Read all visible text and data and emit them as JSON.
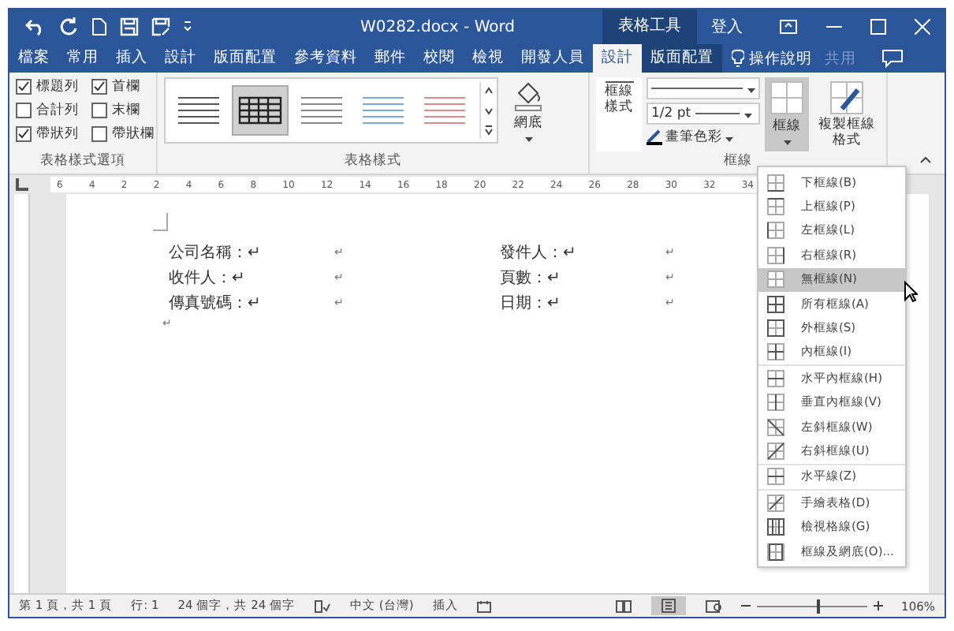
{
  "title_bar": {
    "document_title": "W0282.docx - Word",
    "context_label": "表格工具",
    "sign_in": "登入"
  },
  "tabs": [
    {
      "label": "檔案",
      "selected": false,
      "contextual": false
    },
    {
      "label": "常用",
      "selected": false,
      "contextual": false
    },
    {
      "label": "插入",
      "selected": false,
      "contextual": false
    },
    {
      "label": "設計",
      "selected": false,
      "contextual": false
    },
    {
      "label": "版面配置",
      "selected": false,
      "contextual": false
    },
    {
      "label": "參考資料",
      "selected": false,
      "contextual": false
    },
    {
      "label": "郵件",
      "selected": false,
      "contextual": false
    },
    {
      "label": "校閱",
      "selected": false,
      "contextual": false
    },
    {
      "label": "檢視",
      "selected": false,
      "contextual": false
    },
    {
      "label": "開發人員",
      "selected": false,
      "contextual": false
    },
    {
      "label": "設計",
      "selected": true,
      "contextual": true
    },
    {
      "label": "版面配置",
      "selected": false,
      "contextual": true
    }
  ],
  "tell_me": "操作說明",
  "share": {
    "label": "共用",
    "disabled": true
  },
  "style_options": {
    "title": "表格樣式選項",
    "items": [
      {
        "label": "標題列",
        "checked": true
      },
      {
        "label": "首欄",
        "checked": true
      },
      {
        "label": "合計列",
        "checked": false
      },
      {
        "label": "末欄",
        "checked": false
      },
      {
        "label": "帶狀列",
        "checked": true
      },
      {
        "label": "帶狀欄",
        "checked": false
      }
    ]
  },
  "table_styles": {
    "title": "表格樣式",
    "styles": [
      {
        "selected": false,
        "color": "#555555"
      },
      {
        "selected": true,
        "color": "#222222"
      },
      {
        "selected": false,
        "color": "#888888"
      },
      {
        "selected": false,
        "color": "#7fa7d8"
      },
      {
        "selected": false,
        "color": "#e08a8a"
      }
    ],
    "shading": "網底"
  },
  "borders_group": {
    "title": "框線",
    "border_styles": "框線樣式",
    "pen_weight": "1/2 pt",
    "pen_color": "畫筆色彩",
    "borders": {
      "label": "框線",
      "pressed": true
    },
    "border_painter": "複製框線格式"
  },
  "ruler": [
    "6",
    "4",
    "2",
    "2",
    "4",
    "6",
    "8",
    "10",
    "12",
    "14",
    "16",
    "18",
    "20",
    "22",
    "24",
    "26",
    "28",
    "30",
    "32",
    "34"
  ],
  "document": {
    "rows": [
      [
        "公司名稱：↵",
        "↵",
        "發件人：↵",
        "↵"
      ],
      [
        "收件人：↵",
        "↵",
        "頁數：↵",
        "↵"
      ],
      [
        "傳真號碼：↵",
        "↵",
        "日期：↵",
        "↵"
      ]
    ],
    "end_mark": "↵"
  },
  "menu": {
    "groups": [
      [
        {
          "label": "下框線(B)",
          "kind": "bottom",
          "highlighted": false
        },
        {
          "label": "上框線(P)",
          "kind": "top",
          "highlighted": false
        },
        {
          "label": "左框線(L)",
          "kind": "left",
          "highlighted": false
        },
        {
          "label": "右框線(R)",
          "kind": "right",
          "highlighted": false
        },
        {
          "label": "無框線(N)",
          "kind": "none",
          "highlighted": true
        },
        {
          "label": "所有框線(A)",
          "kind": "all",
          "highlighted": false
        },
        {
          "label": "外框線(S)",
          "kind": "outside",
          "highlighted": false
        },
        {
          "label": "內框線(I)",
          "kind": "inside",
          "highlighted": false
        }
      ],
      [
        {
          "label": "水平內框線(H)",
          "kind": "inside-h",
          "highlighted": false
        },
        {
          "label": "垂直內框線(V)",
          "kind": "inside-v",
          "highlighted": false
        },
        {
          "label": "左斜框線(W)",
          "kind": "diag-down",
          "highlighted": false
        },
        {
          "label": "右斜框線(U)",
          "kind": "diag-up",
          "highlighted": false
        }
      ],
      [
        {
          "label": "水平線(Z)",
          "kind": "hline",
          "highlighted": false
        }
      ],
      [
        {
          "label": "手繪表格(D)",
          "kind": "draw",
          "highlighted": false
        },
        {
          "label": "檢視格線(G)",
          "kind": "gridlines",
          "highlighted": false
        },
        {
          "label": "框線及網底(O)...",
          "kind": "dialog",
          "highlighted": false
        }
      ]
    ]
  },
  "status_bar": {
    "page": "第 1 頁，共 1 頁",
    "line": "行: 1",
    "words": "24 個字，共 24 個字",
    "language": "中文 (台灣)",
    "mode": "插入",
    "zoom": "106%",
    "zoom_level": {
      "level": 0.55
    }
  }
}
